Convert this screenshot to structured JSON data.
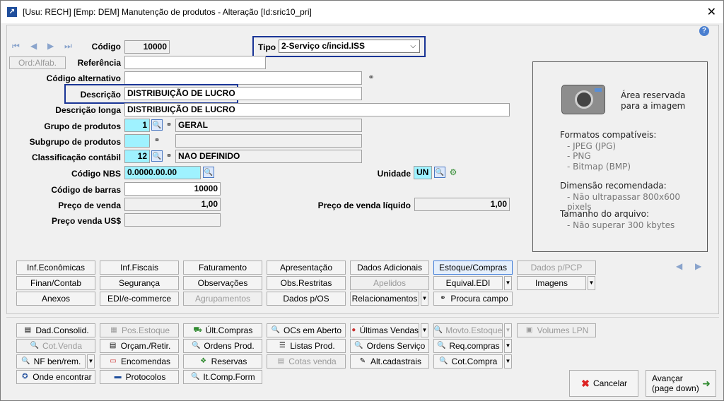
{
  "window": {
    "title": "[Usu: RECH] [Emp: DEM] Manutenção de produtos - Alteração [Id:sric10_pri]"
  },
  "form": {
    "codigo": {
      "label": "Código",
      "value": "10000"
    },
    "tipo": {
      "label": "Tipo",
      "value": "2-Serviço c/incid.ISS"
    },
    "ord_alfab": "Ord:Alfab.",
    "referencia": {
      "label": "Referência",
      "value": ""
    },
    "codigo_alternativo": {
      "label": "Código alternativo",
      "value": ""
    },
    "descricao": {
      "label": "Descrição",
      "value": "DISTRIBUIÇÃO DE LUCRO"
    },
    "descricao_longa": {
      "label": "Descrição longa",
      "value": "DISTRIBUIÇÃO DE LUCRO"
    },
    "grupo": {
      "label": "Grupo de produtos",
      "code": "1",
      "name": "GERAL"
    },
    "subgrupo": {
      "label": "Subgrupo de produtos",
      "code": "",
      "name": ""
    },
    "classificacao": {
      "label": "Classificação contábil",
      "code": "12",
      "name": "NAO DEFINIDO"
    },
    "nbs": {
      "label": "Código NBS",
      "value": "0.0000.00.00"
    },
    "unidade": {
      "label": "Unidade",
      "value": "UN"
    },
    "barras": {
      "label": "Código de barras",
      "value": "10000"
    },
    "preco_venda": {
      "label": "Preço de venda",
      "value": "1,00"
    },
    "preco_liquido": {
      "label": "Preço de venda líquido",
      "value": "1,00"
    },
    "preco_us": {
      "label": "Preço venda US$",
      "value": ""
    }
  },
  "image_panel": {
    "reserved": "Área reservada",
    "reserved2": "para a imagem",
    "formats_title": "Formatos compatíveis:",
    "formats": [
      "- JPEG (JPG)",
      "- PNG",
      "- Bitmap (BMP)"
    ],
    "dim_title": "Dimensão recomendada:",
    "dim": "- Não ultrapassar 800x600 pixels",
    "size_title": "Tamanho do arquivo:",
    "size": "- Não superar 300 kbytes"
  },
  "tabs": {
    "r1": [
      "Inf.Econômicas",
      "Inf.Fiscais",
      "Faturamento",
      "Apresentação",
      "Dados Adicionais",
      "Estoque/Compras",
      "Dados p/PCP"
    ],
    "r2": [
      "Finan/Contab",
      "Segurança",
      "Observações",
      "Obs.Restritas",
      "Apelidos",
      "Equival.EDI",
      "Imagens"
    ],
    "r3": [
      "Anexos",
      "EDI/e-commerce",
      "Agrupamentos",
      "Dados p/OS",
      "Relacionamentos",
      "Procura campo"
    ]
  },
  "actions": {
    "r1": [
      "Dad.Consolid.",
      "Pos.Estoque",
      "Últ.Compras",
      "OCs em Aberto",
      "Últimas Vendas",
      "Movto.Estoque",
      "Volumes LPN"
    ],
    "r2": [
      "Cot.Venda",
      "Orçam./Retir.",
      "Ordens Prod.",
      "Listas Prod.",
      "Ordens Serviço",
      "Req.compras"
    ],
    "r3": [
      "NF ben/rem.",
      "Encomendas",
      "Reservas",
      "Cotas venda",
      "Alt.cadastrais",
      "Cot.Compra"
    ],
    "r4": [
      "Onde encontrar",
      "Protocolos",
      "It.Comp.Form"
    ]
  },
  "footer": {
    "cancel": "Cancelar",
    "next": "Avançar",
    "next_sub": "(page down)"
  }
}
